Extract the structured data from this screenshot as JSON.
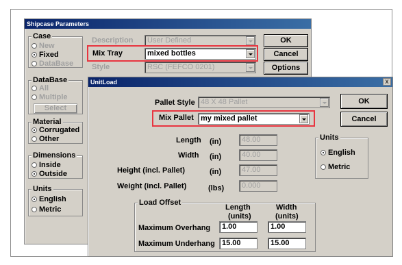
{
  "shipcase": {
    "title": "Shipcase Parameters",
    "case_group": {
      "title": "Case",
      "options": [
        "New",
        "Fixed",
        "DataBase"
      ]
    },
    "database_group": {
      "title": "DataBase",
      "options": [
        "All",
        "Multiple"
      ],
      "select_label": "Select"
    },
    "material_group": {
      "title": "Material",
      "options": [
        "Corrugated",
        "Other"
      ]
    },
    "dimensions_group": {
      "title": "Dimensions",
      "options": [
        "Inside",
        "Outside"
      ]
    },
    "units_group": {
      "title": "Units",
      "options": [
        "English",
        "Metric"
      ]
    },
    "description_label": "Description",
    "description_value": "User Defined",
    "mix_tray_label": "Mix Tray",
    "mix_tray_value": "mixed bottles",
    "style_label": "Style",
    "style_value": "RSC (FEFCO 0201)",
    "ok_label": "OK",
    "cancel_label": "Cancel",
    "options_label": "Options"
  },
  "unitload": {
    "title": "UnitLoad",
    "close": "x",
    "pallet_style_label": "Pallet Style",
    "pallet_style_value": "48 X 48 Pallet",
    "mix_pallet_label": "Mix Pallet",
    "mix_pallet_value": "my mixed pallet",
    "ok_label": "OK",
    "cancel_label": "Cancel",
    "length_label": "Length",
    "length_unit": "(in)",
    "length_value": "48.00",
    "width_label": "Width",
    "width_unit": "(in)",
    "width_value": "40.00",
    "height_label": "Height (incl. Pallet)",
    "height_unit": "(in)",
    "height_value": "47.00",
    "weight_label": "Weight (incl. Pallet)",
    "weight_unit": "(lbs)",
    "weight_value": "0.000",
    "units_group": {
      "title": "Units",
      "options": [
        "English",
        "Metric"
      ]
    },
    "load_offset": {
      "title": "Load Offset",
      "col_length": "Length",
      "col_width": "Width",
      "col_units": "(units)",
      "max_overhang_label": "Maximum Overhang",
      "max_overhang_length": "1.00",
      "max_overhang_width": "1.00",
      "max_underhang_label": "Maximum Underhang",
      "max_underhang_length": "15.00",
      "max_underhang_width": "15.00"
    }
  },
  "colors": {
    "highlight": "#e8343f",
    "title_active": "#0a246a",
    "dialog_bg": "#d4d0c8"
  }
}
